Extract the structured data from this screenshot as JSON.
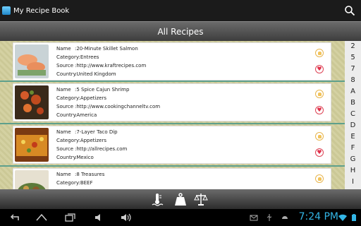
{
  "app": {
    "title": "My Recipe Book"
  },
  "header": {
    "title": "All Recipes"
  },
  "labels": {
    "name": "Name",
    "category": "Category",
    "source": "Source",
    "country": "Country"
  },
  "recipes": [
    {
      "name": ":20-Minute Skillet Salmon",
      "category": ":Entrees",
      "source": ":http://www.kraftrecipes.com",
      "country": ":United Kingdom",
      "favorite": true
    },
    {
      "name": ":5 Spice Cajun Shrimp",
      "category": ":Appetizers",
      "source": ":http://www.cookingchanneltv.com",
      "country": ":America",
      "favorite": true
    },
    {
      "name": ":7-Layer Taco Dip",
      "category": ":Appetizers",
      "source": ":http://allrecipes.com",
      "country": ":Mexico",
      "favorite": true
    },
    {
      "name": ":8 Treasures",
      "category": ":BEEF",
      "source": "",
      "country": "",
      "favorite": false
    }
  ],
  "index": [
    "2",
    "5",
    "7",
    "8",
    "A",
    "B",
    "C",
    "D",
    "E",
    "F",
    "G",
    "H",
    "I"
  ],
  "statusbar": {
    "time": "7:24 PM"
  },
  "colors": {
    "accent": "#33b5e5",
    "divider": "#5ea08c",
    "heart": "#e0304a"
  }
}
